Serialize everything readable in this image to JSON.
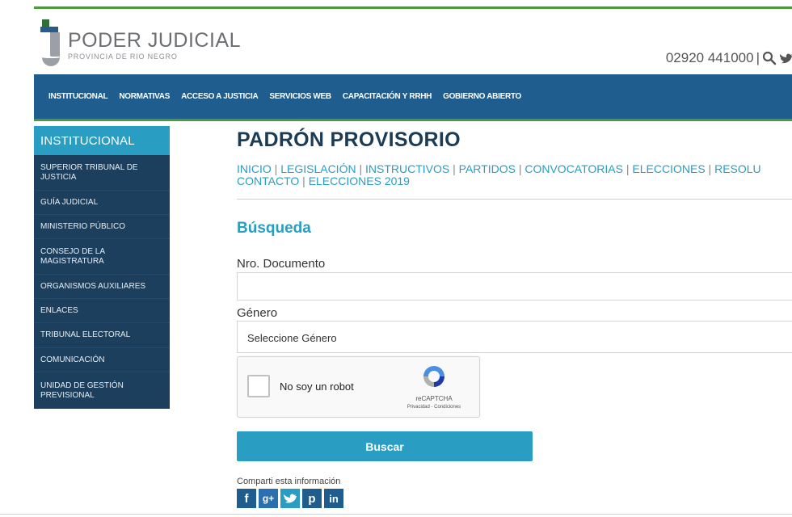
{
  "header": {
    "logo_title": "PODER JUDICIAL",
    "logo_subtitle": "PROVINCIA DE RIO NEGRO",
    "phone": "02920 441000",
    "separator": "|",
    "icons": [
      "search-icon",
      "twitter-icon"
    ]
  },
  "nav": {
    "items": [
      {
        "label": "INSTITUCIONAL"
      },
      {
        "label": "NORMATIVAS"
      },
      {
        "label": "ACCESO A JUSTICIA"
      },
      {
        "label": "SERVICIOS WEB"
      },
      {
        "label": "CAPACITACIÓN Y RRHH"
      },
      {
        "label": "GOBIERNO ABIERTO"
      }
    ]
  },
  "sidebar": {
    "heading": "INSTITUCIONAL",
    "items": [
      {
        "label": "SUPERIOR TRIBUNAL DE JUSTICIA"
      },
      {
        "label": "GUÍA JUDICIAL"
      },
      {
        "label": "MINISTERIO PÚBLICO"
      },
      {
        "label": "CONSEJO DE LA MAGISTRATURA"
      },
      {
        "label": "ORGANISMOS AUXILIARES"
      },
      {
        "label": "ENLACES"
      },
      {
        "label": "TRIBUNAL ELECTORAL"
      },
      {
        "label": "COMUNICACIÓN"
      },
      {
        "label": "UNIDAD DE GESTIÓN PREVISIONAL"
      }
    ]
  },
  "main": {
    "title": "PADRÓN PROVISORIO",
    "breadcrumbs": [
      {
        "label": "INICIO"
      },
      {
        "label": "LEGISLACIÓN"
      },
      {
        "label": "INSTRUCTIVOS"
      },
      {
        "label": "PARTIDOS"
      },
      {
        "label": "CONVOCATORIAS"
      },
      {
        "label": "ELECCIONES"
      },
      {
        "label": "RESOLU"
      },
      {
        "label": "CONTACTO"
      },
      {
        "label": "ELECCIONES 2019"
      }
    ],
    "breadcrumb_separator": "|",
    "section_title": "Búsqueda",
    "document_label": "Nro. Documento",
    "document_value": "",
    "gender_label": "Género",
    "gender_selected": "Seleccione Género",
    "recaptcha": {
      "label": "No soy un robot",
      "brand": "reCAPTCHA",
      "links": "Privacidad - Condiciones"
    },
    "submit_label": "Buscar",
    "share_label": "Comparti esta información",
    "social": [
      {
        "icon": "facebook-icon",
        "glyph": "f"
      },
      {
        "icon": "google-plus-icon",
        "glyph": "g+"
      },
      {
        "icon": "twitter-icon",
        "glyph": ""
      },
      {
        "icon": "pinterest-icon",
        "glyph": "p"
      },
      {
        "icon": "linkedin-icon",
        "glyph": "in"
      }
    ]
  },
  "colors": {
    "nav_blue": "#1f5d8e",
    "accent_cyan": "#2a9dc2",
    "green_line": "#4c9a3c",
    "sidebar_dark": "#1b3f5c",
    "title_navy": "#1c3b55"
  }
}
